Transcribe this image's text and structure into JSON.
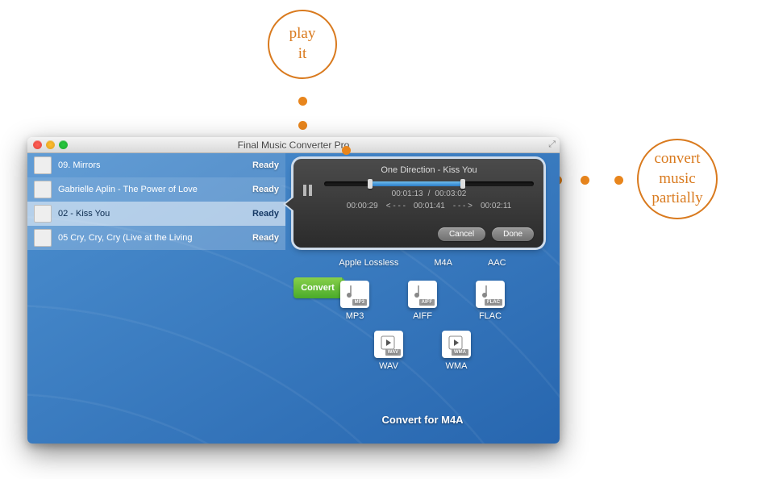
{
  "callouts": {
    "top": "play\nit",
    "right": "convert\nmusic\npartially"
  },
  "window": {
    "title": "Final Music Converter Pro"
  },
  "tracks": [
    {
      "name": "09. Mirrors",
      "status": "Ready"
    },
    {
      "name": "Gabrielle Aplin - The Power of Love",
      "status": "Ready"
    },
    {
      "name": "02 - Kiss You",
      "status": "Ready"
    },
    {
      "name": "05 Cry, Cry, Cry (Live at the Living",
      "status": "Ready"
    }
  ],
  "row1_labels": [
    "Apple Lossless",
    "M4A",
    "AAC"
  ],
  "convert_label": "Convert",
  "formats_row2": [
    "MP3",
    "AIFF",
    "FLAC"
  ],
  "formats_row3": [
    "WAV",
    "WMA"
  ],
  "footer": "Convert for M4A",
  "player": {
    "track": "One Direction - Kiss You",
    "elapsed": "00:01:13",
    "total": "00:03:02",
    "separator": "/",
    "start_mark": "00:00:29",
    "mid_mark": "00:01:41",
    "end_mark": "00:02:11",
    "arrow_left": "< - - -",
    "arrow_right": "- - - >",
    "cancel": "Cancel",
    "done": "Done"
  }
}
